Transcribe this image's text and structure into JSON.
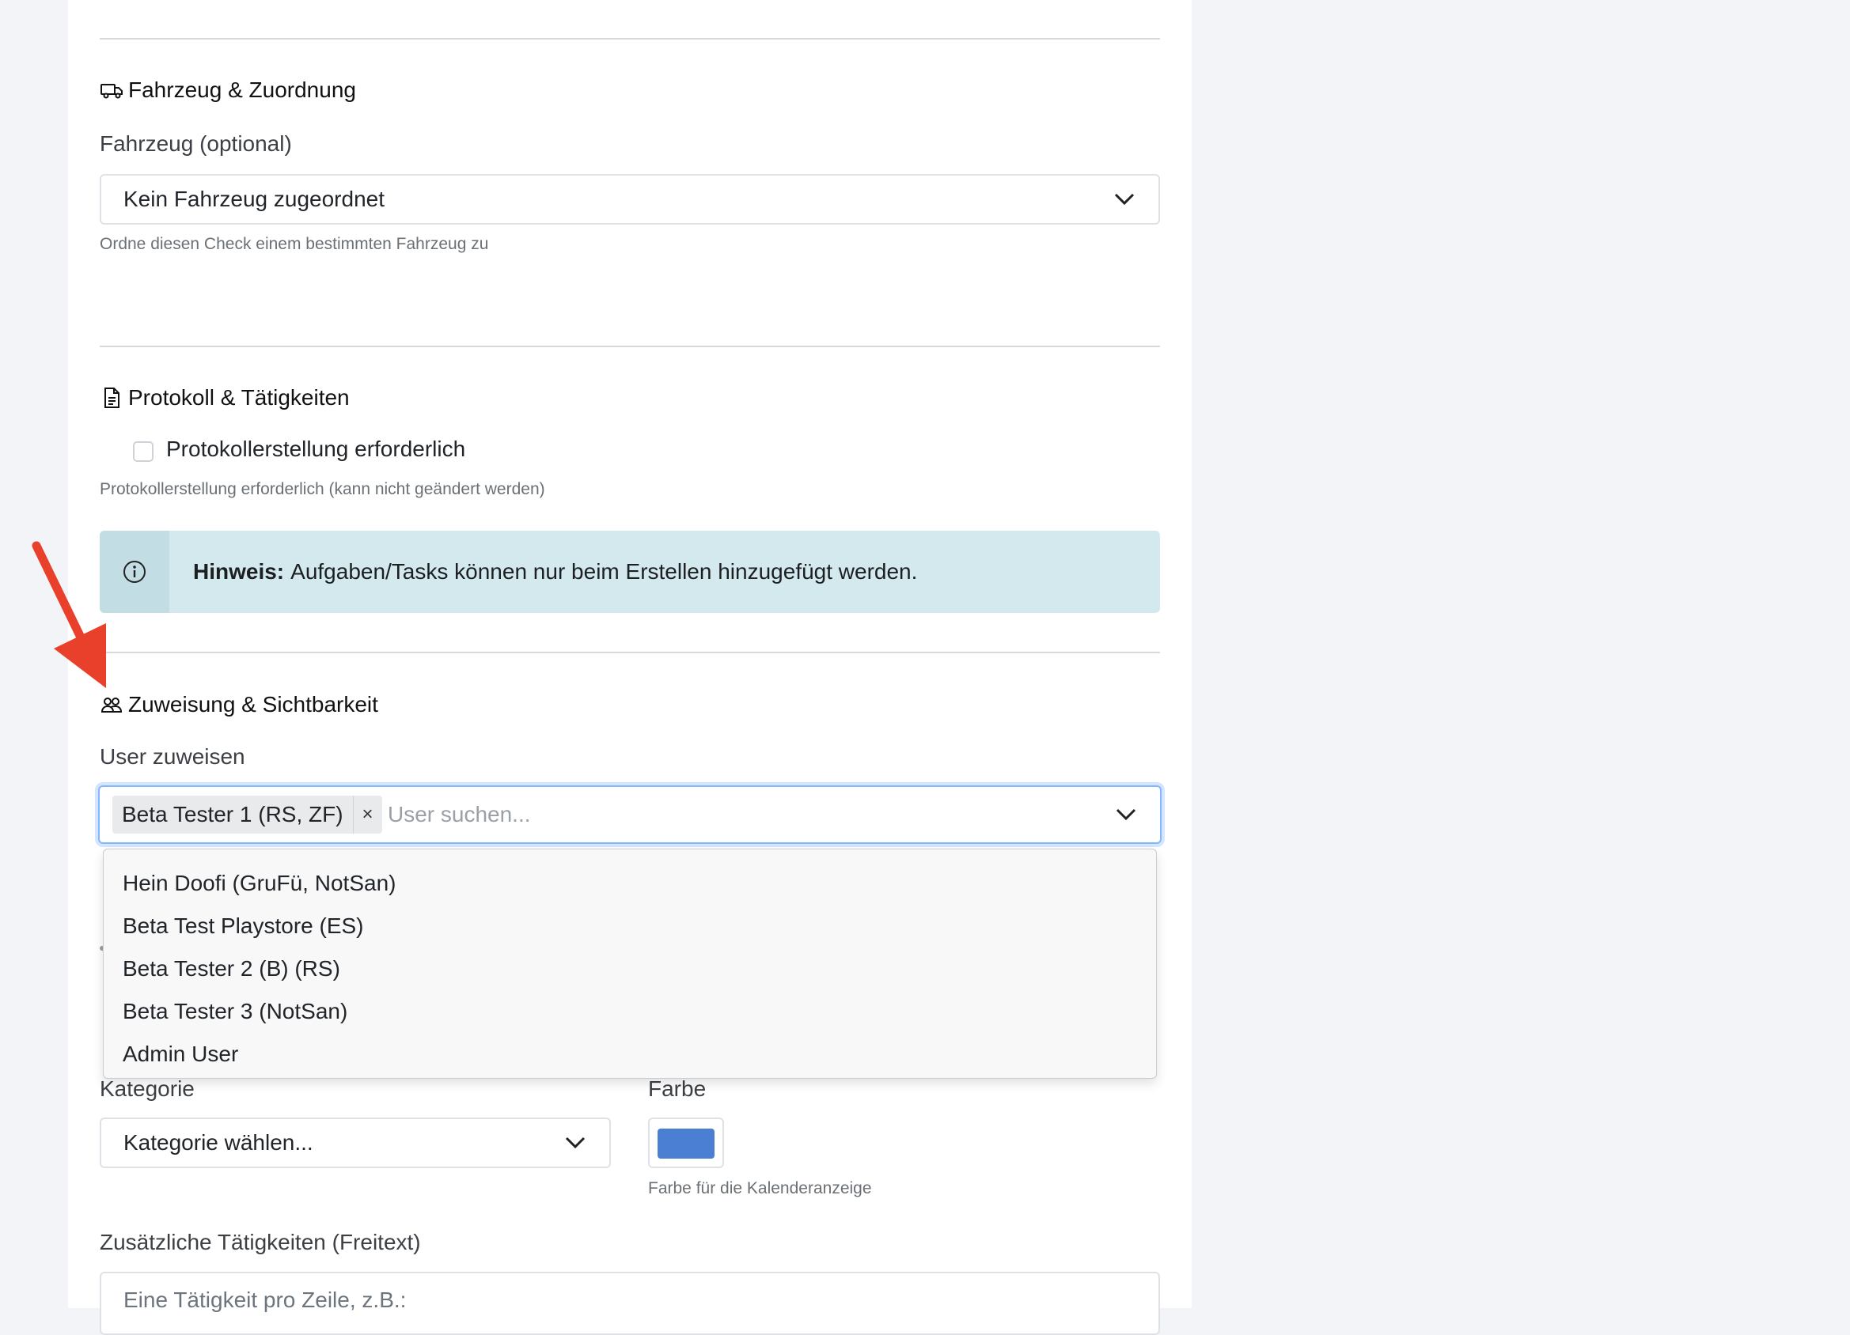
{
  "vehicle_section": {
    "title": "Fahrzeug & Zuordnung",
    "icon": "truck-icon",
    "field_label": "Fahrzeug (optional)",
    "select_value": "Kein Fahrzeug zugeordnet",
    "help": "Ordne diesen Check einem bestimmten Fahrzeug zu"
  },
  "protocol_section": {
    "title": "Protokoll & Tätigkeiten",
    "icon": "document-icon",
    "checkbox_label": "Protokollerstellung erforderlich",
    "checkbox_checked": false,
    "help": "Protokollerstellung erforderlich (kann nicht geändert werden)",
    "alert_bold": "Hinweis:",
    "alert_text": "Aufgaben/Tasks können nur beim Erstellen hinzugefügt werden."
  },
  "assignment_section": {
    "title": "Zuweisung & Sichtbarkeit",
    "icon": "users-icon",
    "field_label": "User zuweisen",
    "selected_tag": "Beta Tester 1 (RS, ZF)",
    "tag_remove": "×",
    "search_placeholder": "User suchen...",
    "options": [
      "Hein Doofi (GruFü, NotSan)",
      "Beta Test Playstore (ES)",
      "Beta Tester 2 (B) (RS)",
      "Beta Tester 3 (NotSan)",
      "Admin User"
    ]
  },
  "category": {
    "label": "Kategorie",
    "select_value": "Kategorie wählen..."
  },
  "color": {
    "label": "Farbe",
    "value": "#4a7fd4",
    "help": "Farbe für die Kalenderanzeige"
  },
  "extra_tasks": {
    "label": "Zusätzliche Tätigkeiten (Freitext)",
    "placeholder": "Eine Tätigkeit pro Zeile, z.B.:"
  },
  "annotation_arrow_color": "#e8402a"
}
